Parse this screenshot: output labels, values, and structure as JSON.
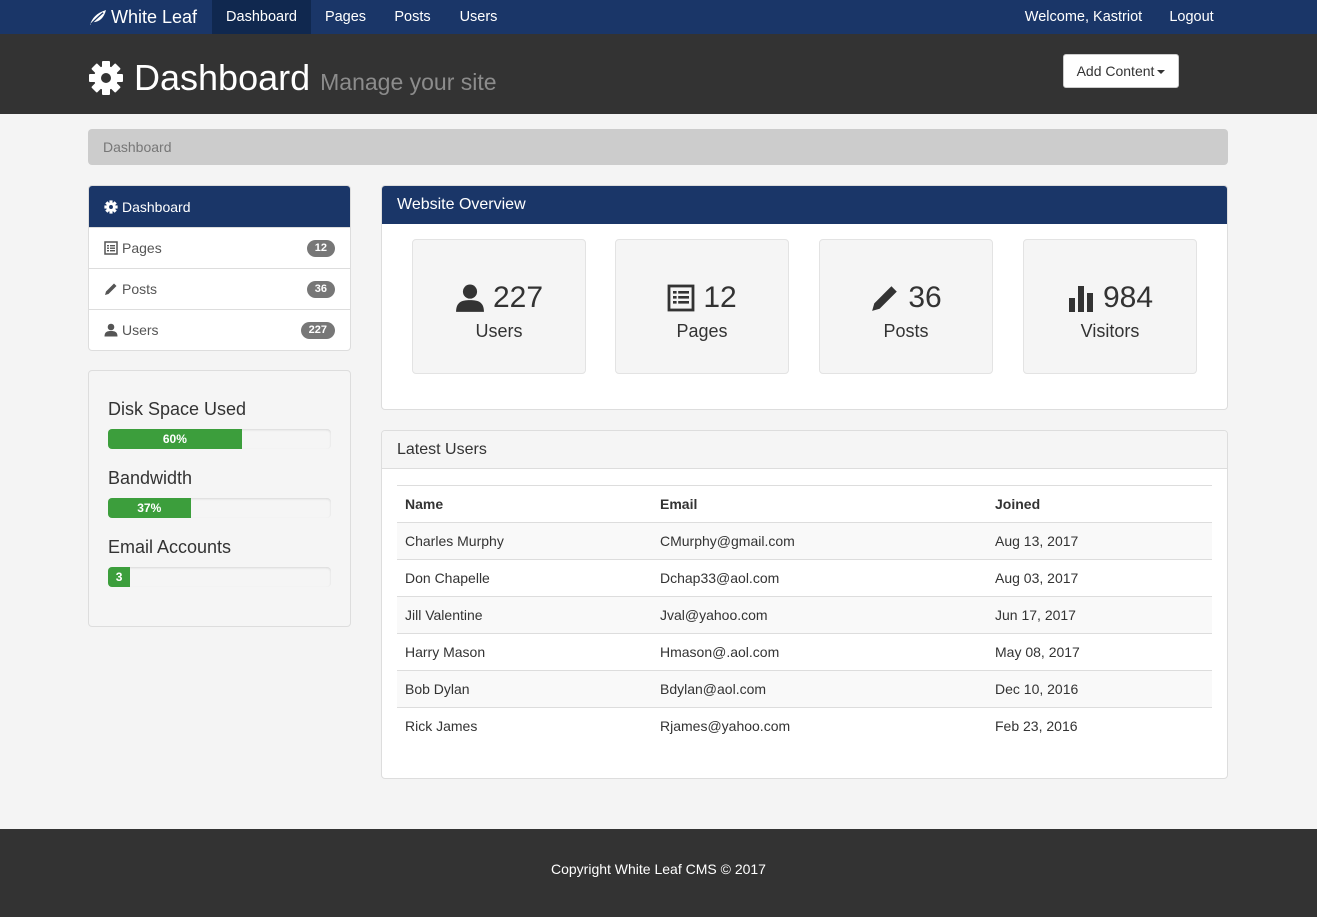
{
  "navbar": {
    "brand": "White Leaf",
    "links": [
      {
        "label": "Dashboard",
        "active": true
      },
      {
        "label": "Pages",
        "active": false
      },
      {
        "label": "Posts",
        "active": false
      },
      {
        "label": "Users",
        "active": false
      }
    ],
    "welcome": "Welcome, Kastriot",
    "logout": "Logout"
  },
  "header": {
    "title": "Dashboard",
    "subtitle": "Manage your site",
    "add_content_label": "Add Content"
  },
  "breadcrumb": {
    "current": "Dashboard"
  },
  "sidebar": {
    "items": [
      {
        "label": "Dashboard",
        "icon": "gear-icon",
        "active": true
      },
      {
        "label": "Pages",
        "icon": "list-icon",
        "badge": "12"
      },
      {
        "label": "Posts",
        "icon": "pencil-icon",
        "badge": "36"
      },
      {
        "label": "Users",
        "icon": "user-icon",
        "badge": "227"
      }
    ]
  },
  "stats": {
    "disk": {
      "label": "Disk Space Used",
      "percent": 60,
      "text": "60%"
    },
    "bandwidth": {
      "label": "Bandwidth",
      "percent": 37,
      "text": "37%"
    },
    "email": {
      "label": "Email Accounts",
      "value_percent": 10,
      "text": "3"
    }
  },
  "overview": {
    "title": "Website Overview",
    "cards": [
      {
        "icon": "user-icon",
        "value": "227",
        "label": "Users"
      },
      {
        "icon": "list-icon",
        "value": "12",
        "label": "Pages"
      },
      {
        "icon": "pencil-icon",
        "value": "36",
        "label": "Posts"
      },
      {
        "icon": "bar-chart-icon",
        "value": "984",
        "label": "Visitors"
      }
    ]
  },
  "latest_users": {
    "title": "Latest Users",
    "columns": [
      "Name",
      "Email",
      "Joined"
    ],
    "rows": [
      [
        "Charles Murphy",
        "CMurphy@gmail.com",
        "Aug 13, 2017"
      ],
      [
        "Don Chapelle",
        "Dchap33@aol.com",
        "Aug 03, 2017"
      ],
      [
        "Jill Valentine",
        "Jval@yahoo.com",
        "Jun 17, 2017"
      ],
      [
        "Harry Mason",
        "Hmason@.aol.com",
        "May 08, 2017"
      ],
      [
        "Bob Dylan",
        "Bdylan@aol.com",
        "Dec 10, 2016"
      ],
      [
        "Rick James",
        "Rjames@yahoo.com",
        "Feb 23, 2016"
      ]
    ]
  },
  "footer": {
    "text": "Copyright White Leaf CMS © 2017"
  },
  "colors": {
    "primary": "#1a3668",
    "header_bg": "#333333",
    "progress_success": "#3c9e3c",
    "badge": "#777777"
  }
}
